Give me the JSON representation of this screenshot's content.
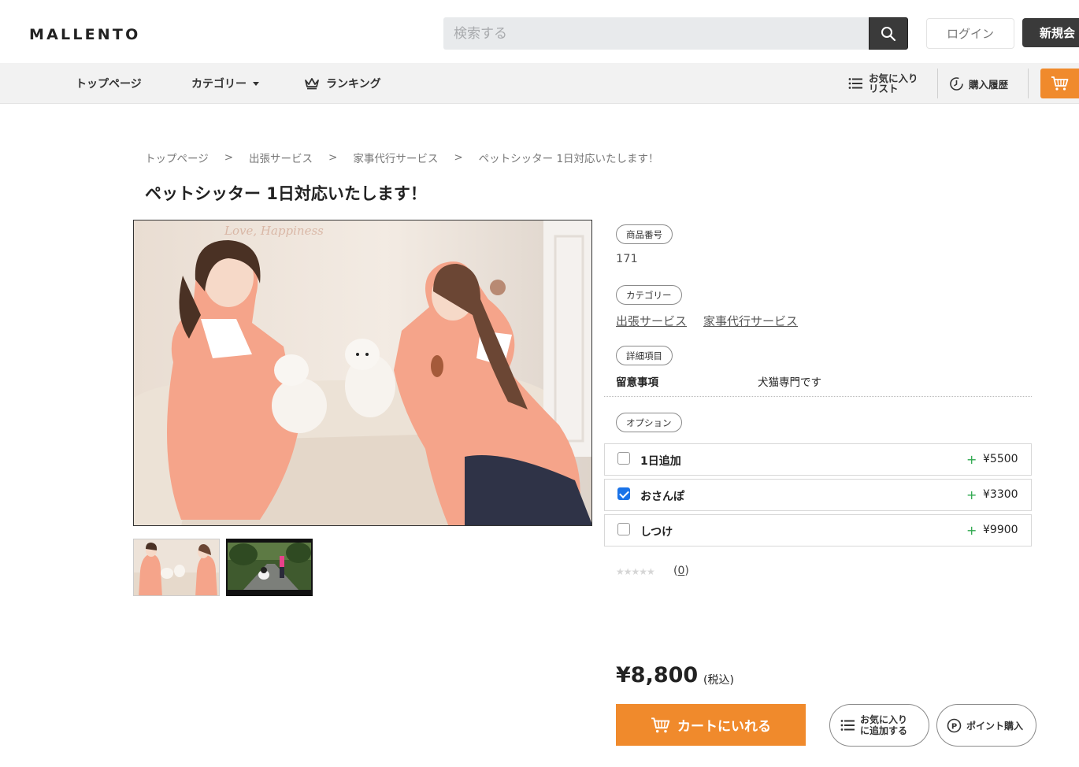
{
  "header": {
    "logo": "MALLENTO",
    "search_placeholder": "検索する",
    "login_label": "ログイン",
    "register_label": "新規会"
  },
  "nav": {
    "top_page": "トップページ",
    "category": "カテゴリー",
    "ranking": "ランキング",
    "favorites_line1": "お気に入り",
    "favorites_line2": "リスト",
    "purchase_history": "購入履歴"
  },
  "breadcrumb": {
    "items": [
      "トップページ",
      "出張サービス",
      "家事代行サービス",
      "ペットシッター 1日対応いたします！"
    ],
    "separator": ">"
  },
  "product": {
    "title": "ペットシッター 1日対応いたします！",
    "number_label": "商品番号",
    "number": "171",
    "category_label": "カテゴリー",
    "categories": [
      "出張サービス",
      "家事代行サービス"
    ],
    "details_label": "詳細項目",
    "details": [
      {
        "label": "留意事項",
        "value": "犬猫専門です"
      }
    ],
    "options_label": "オプション",
    "options": [
      {
        "label": "1日追加",
        "plus": "+",
        "price": "¥5500",
        "checked": false
      },
      {
        "label": "おさんぽ",
        "plus": "+",
        "price": "¥3300",
        "checked": true
      },
      {
        "label": "しつけ",
        "plus": "+",
        "price": "¥9900",
        "checked": false
      }
    ],
    "stars": "★★★★★",
    "review_open": "(",
    "review_count": "0",
    "review_close": ")",
    "price": "¥8,800",
    "tax_note": "(税込)",
    "cart_button": "カートにいれる",
    "favorite_button_line1": "お気に入り",
    "favorite_button_line2": "に追加する",
    "point_button": "ポイント購入"
  },
  "colors": {
    "accent": "#f08a2c",
    "dark": "#3a3a3a",
    "plus_green": "#2fa84f",
    "check_blue": "#1a73e8"
  },
  "icons": [
    "search-icon",
    "crown-icon",
    "list-icon",
    "clock-icon",
    "cart-icon",
    "point-icon"
  ]
}
